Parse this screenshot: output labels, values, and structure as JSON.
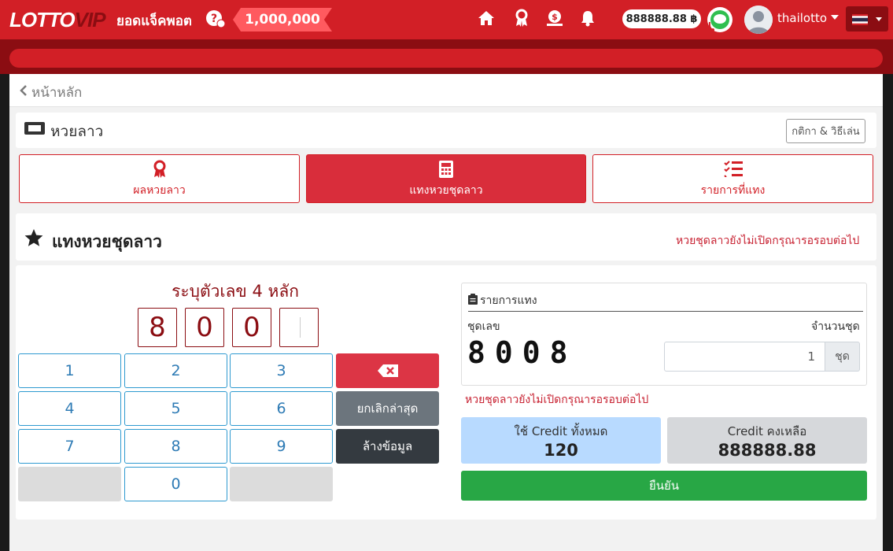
{
  "header": {
    "logo_main": "LOTTO",
    "logo_sub": "VIP",
    "jackpot_label": "ยอดแจ็คพอต",
    "jackpot_value": "1,000,000",
    "credit": "888888.88 ฿",
    "username": "thailotto",
    "icons": [
      "home-icon",
      "award-icon",
      "money-icon",
      "bell-icon",
      "line-chat-icon"
    ]
  },
  "breadcrumb": {
    "back_label": "หน้าหลัก"
  },
  "lottery_header": {
    "title": "หวยลาว",
    "rules_button": "กติกา & วิธีเล่น"
  },
  "tabs": [
    {
      "label": "ผลหวยลาว",
      "icon": "award-icon",
      "active": false
    },
    {
      "label": "แทงหวยชุดลาว",
      "icon": "calculator-icon",
      "active": true
    },
    {
      "label": "รายการที่แทง",
      "icon": "list-check-icon",
      "active": false
    }
  ],
  "bet_section": {
    "title": "แทงหวยชุดลาว",
    "closed_notice": "หวยชุดลาวยังไม่เปิดกรุณารอรอบต่อไป"
  },
  "number_input": {
    "prompt": "ระบุตัวเลข 4 หลัก",
    "digits": [
      "8",
      "0",
      "0",
      ""
    ]
  },
  "keypad": {
    "keys": [
      "1",
      "2",
      "3",
      "4",
      "5",
      "6",
      "7",
      "8",
      "9",
      "0"
    ],
    "undo_label": "ยกเลิกล่าสุด",
    "clear_label": "ล้างข้อมูล"
  },
  "bet_list": {
    "title": "รายการแทง",
    "set_number_label": "ชุดเลข",
    "set_number": "8008",
    "quantity_label": "จำนวนชุด",
    "quantity_value": "1",
    "quantity_unit": "ชุด",
    "notice": "หวยชุดลาวยังไม่เปิดกรุณารอรอบต่อไป"
  },
  "summary": {
    "used_label": "ใช้ Credit ทั้งหมด",
    "used_value": "120",
    "remaining_label": "Credit คงเหลือ",
    "remaining_value": "888888.88"
  },
  "confirm_label": "ยืนยัน",
  "colors": {
    "brand_red": "#d21f26",
    "dark_red": "#8b0d12",
    "success": "#28a745"
  }
}
